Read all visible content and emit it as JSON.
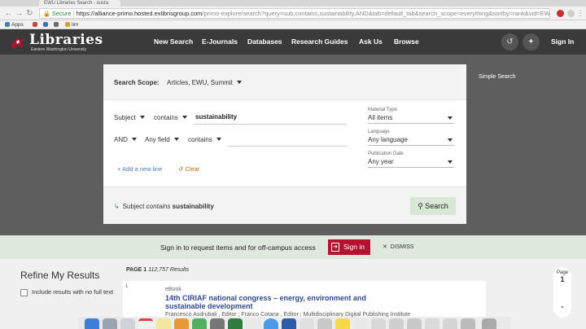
{
  "browser": {
    "tab_title": "EWU Libraries Search - susta",
    "secure_label": "Secure",
    "url_host": "https://alliance-primo.hosted.exlibrisgroup.com",
    "url_rest": "/primo-explore/search?query=sub,contains,sustainability,AND&tab=default_tab&search_scope=everything&sortby=rank&vid=EW...",
    "bookmarks": [
      {
        "label": "Apps",
        "icon": "apps-grid-icon"
      },
      {
        "label": "",
        "icon": "bookmark-site-icon"
      },
      {
        "label": "",
        "icon": "bookmark-site-icon"
      },
      {
        "label": "",
        "icon": "bookmark-site-icon"
      },
      {
        "label": "lim",
        "icon": "bookmark-site-icon"
      }
    ]
  },
  "header": {
    "logo_title": "Libraries",
    "logo_subtitle": "Eastern Washington University",
    "nav": [
      {
        "label": "New Search"
      },
      {
        "label": "E-Journals"
      },
      {
        "label": "Databases"
      },
      {
        "label": "Research Guides"
      },
      {
        "label": "Ask Us"
      },
      {
        "label": "Browse"
      }
    ],
    "signin_label": "Sign In"
  },
  "search": {
    "scope_label": "Search Scope:",
    "scope_value": "Articles, EWU, Summit",
    "row1": {
      "field": "Subject",
      "operator": "contains",
      "query": "sustainability"
    },
    "row2": {
      "boolean": "AND",
      "field": "Any field",
      "operator": "contains",
      "query": ""
    },
    "filters": [
      {
        "label": "Material Type",
        "value": "All items"
      },
      {
        "label": "Language",
        "value": "Any language"
      },
      {
        "label": "Publication Date",
        "value": "Any year"
      }
    ],
    "add_line_label": "Add a new line",
    "clear_label": "Clear",
    "summary": {
      "field": "Subject",
      "operator": "contains",
      "term": "sustainability"
    },
    "search_button_label": "Search",
    "simple_search_label": "Simple Search"
  },
  "banner": {
    "text": "Sign in to request items and for off-campus access",
    "signin_label": "Sign in",
    "dismiss_label": "DISMISS"
  },
  "results": {
    "refine_title": "Refine My Results",
    "checkbox_label": "Include results with no full text",
    "page_label": "PAGE 1",
    "count_text": "112,757 Results",
    "items": [
      {
        "number": "1",
        "type": "eBook",
        "title": "14th CIRIAF national congress – energy, environment and sustainable development",
        "authors": "Francesco Asdrubali , Editor ; Franco Cotana , Editor ; Multidisciplinary Digital Publishing Institute"
      }
    ],
    "pager": {
      "label": "Page",
      "number": "1"
    }
  },
  "colors": {
    "header_bg": "#3a3a3a",
    "content_bg": "#5e5e5e",
    "signin_red": "#b4122e",
    "link_blue": "#2f4a8f",
    "search_green": "#d9e8d6"
  }
}
